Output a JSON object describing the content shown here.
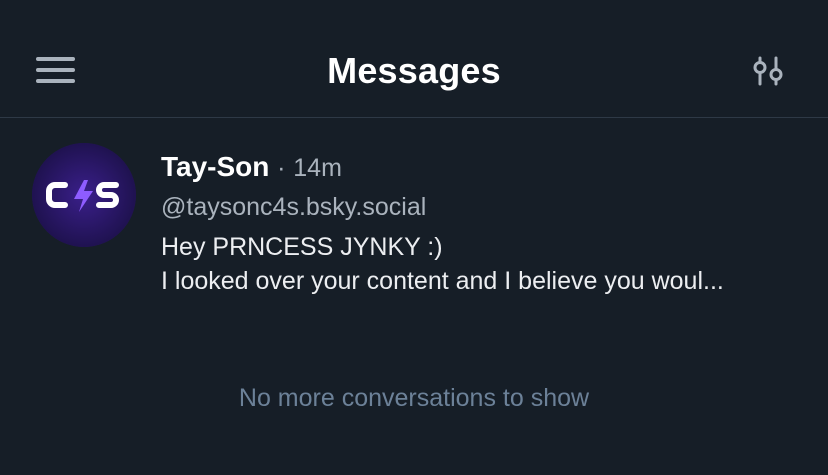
{
  "header": {
    "title": "Messages",
    "menu_icon": "hamburger-menu-icon",
    "filter_icon": "sliders-icon"
  },
  "conversations": [
    {
      "avatar_text": "C4S",
      "name": "Tay-Son",
      "separator": "·",
      "time": "14m",
      "handle": "@taysonc4s.bsky.social",
      "preview_line1": "Hey PRNCESS JYNKY :)",
      "preview_line2": "I looked over your content and I believe you woul..."
    }
  ],
  "footer": {
    "empty_text": "No more conversations to show"
  },
  "colors": {
    "background": "#161e27",
    "divider": "#2e3946",
    "avatar_bg": "#23155a",
    "accent_purple": "#7c4dff"
  }
}
